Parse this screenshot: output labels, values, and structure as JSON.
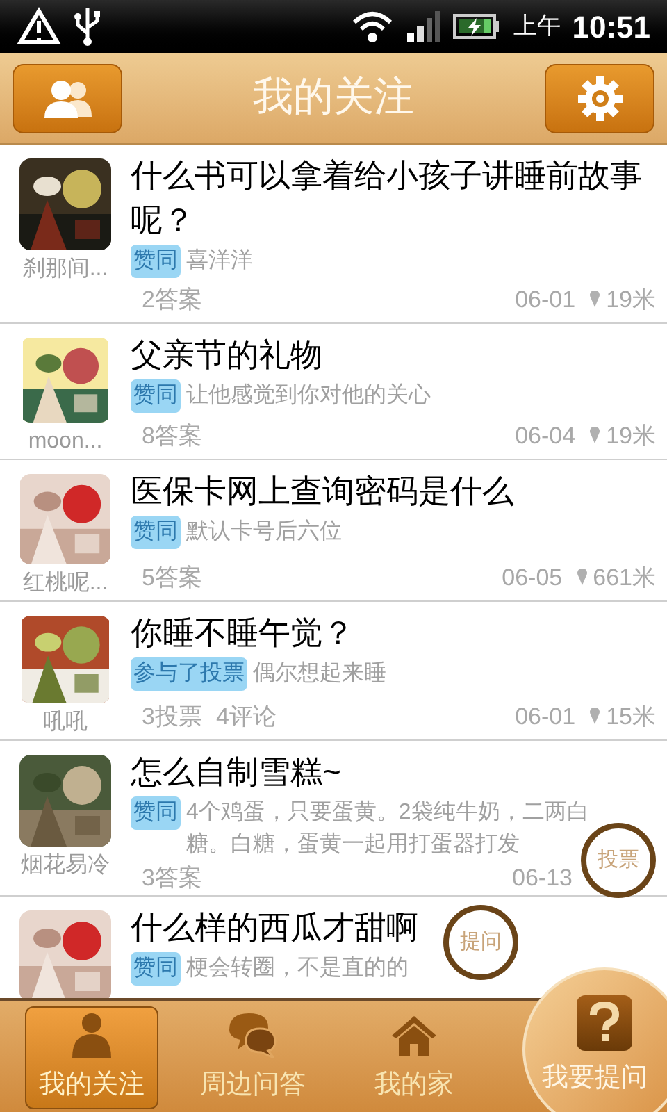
{
  "status_bar": {
    "am_pm": "上午",
    "time": "10:51"
  },
  "header": {
    "title": "我的关注"
  },
  "questions": [
    {
      "user": "刹那间...",
      "title": "什么书可以拿着给小孩子讲睡前故事呢？",
      "tag": "赞同",
      "answer": "喜洋洋",
      "counts": [
        "2答案"
      ],
      "date": "06-01",
      "distance": "19米"
    },
    {
      "user": "moon...",
      "title": "父亲节的礼物",
      "tag": "赞同",
      "answer": "让他感觉到你对他的关心",
      "counts": [
        "8答案"
      ],
      "date": "06-04",
      "distance": "19米"
    },
    {
      "user": "红桃呢...",
      "title": "医保卡网上查询密码是什么",
      "tag": "赞同",
      "answer": "默认卡号后六位",
      "counts": [
        "5答案"
      ],
      "date": "06-05",
      "distance": "661米"
    },
    {
      "user": "吼吼",
      "title": "你睡不睡午觉？",
      "tag": "参与了投票",
      "answer": "偶尔想起来睡",
      "counts": [
        "3投票",
        "4评论"
      ],
      "date": "06-01",
      "distance": "15米"
    },
    {
      "user": "烟花易冷",
      "title": "怎么自制雪糕~",
      "tag": "赞同",
      "answer": "4个鸡蛋，只要蛋黄。2袋纯牛奶，二两白糖。白糖，蛋黄一起用打蛋器打发",
      "counts": [
        "3答案"
      ],
      "date": "06-13"
    },
    {
      "title": "什么样的西瓜才甜啊",
      "tag": "赞同",
      "answer": "梗会转圈，不是直的的"
    }
  ],
  "floating_buttons": [
    "投票",
    "提问"
  ],
  "tabs": [
    {
      "label": "我的关注",
      "selected": true
    },
    {
      "label": "周边问答",
      "selected": false
    },
    {
      "label": "我的家",
      "selected": false
    }
  ],
  "ask_button": {
    "label": "我要提问"
  }
}
